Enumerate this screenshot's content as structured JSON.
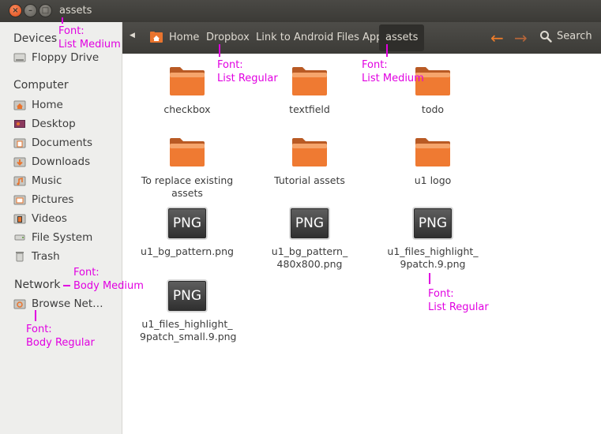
{
  "window": {
    "title": "assets"
  },
  "toolbar": {
    "breadcrumbs": [
      "Home",
      "Dropbox",
      "Link to Android Files App",
      "assets"
    ],
    "search_label": "Search"
  },
  "sidebar": {
    "devices": {
      "heading": "Devices",
      "items": [
        {
          "label": "Floppy Drive",
          "icon": "floppy-drive-icon"
        }
      ]
    },
    "computer": {
      "heading": "Computer",
      "items": [
        {
          "label": "Home",
          "icon": "home-folder-icon"
        },
        {
          "label": "Desktop",
          "icon": "desktop-icon"
        },
        {
          "label": "Documents",
          "icon": "documents-folder-icon"
        },
        {
          "label": "Downloads",
          "icon": "downloads-folder-icon"
        },
        {
          "label": "Music",
          "icon": "music-folder-icon"
        },
        {
          "label": "Pictures",
          "icon": "pictures-folder-icon"
        },
        {
          "label": "Videos",
          "icon": "videos-folder-icon"
        },
        {
          "label": "File System",
          "icon": "file-system-icon"
        },
        {
          "label": "Trash",
          "icon": "trash-icon"
        }
      ]
    },
    "network": {
      "heading": "Network",
      "items": [
        {
          "label": "Browse Net…",
          "icon": "network-icon"
        }
      ]
    }
  },
  "files": [
    {
      "line1": "checkbox",
      "line2": "",
      "type": "folder"
    },
    {
      "line1": "textfield",
      "line2": "",
      "type": "folder"
    },
    {
      "line1": "todo",
      "line2": "",
      "type": "folder"
    },
    {
      "line1": "To replace existing",
      "line2": "assets",
      "type": "folder"
    },
    {
      "line1": "Tutorial assets",
      "line2": "",
      "type": "folder"
    },
    {
      "line1": "u1 logo",
      "line2": "",
      "type": "folder"
    },
    {
      "line1": "u1_bg_pattern.png",
      "line2": "",
      "type": "png",
      "badge": "PNG"
    },
    {
      "line1": "u1_bg_pattern_",
      "line2": "480x800.png",
      "type": "png",
      "badge": "PNG"
    },
    {
      "line1": "u1_files_highlight_",
      "line2": "9patch.9.png",
      "type": "png",
      "badge": "PNG"
    },
    {
      "line1": "u1_files_highlight_",
      "line2": "9patch_small.9.png",
      "type": "png",
      "badge": "PNG"
    }
  ],
  "annotations": [
    {
      "line1": "Font:",
      "line2": "List Medium"
    },
    {
      "line1": "Font:",
      "line2": "List Regular"
    },
    {
      "line1": "Font:",
      "line2": "List Medium"
    },
    {
      "line1": "Font:",
      "line2": "Body Medium"
    },
    {
      "line1": "Font:",
      "line2": "Body Regular"
    },
    {
      "line1": "Font:",
      "line2": "List Regular"
    }
  ],
  "colors": {
    "annotation": "#e100e1",
    "folder_orange": "#ef7a32",
    "close_button": "#df4a16",
    "titlebar": "#3c3b37",
    "nav_arrow": "#f07d2a"
  }
}
